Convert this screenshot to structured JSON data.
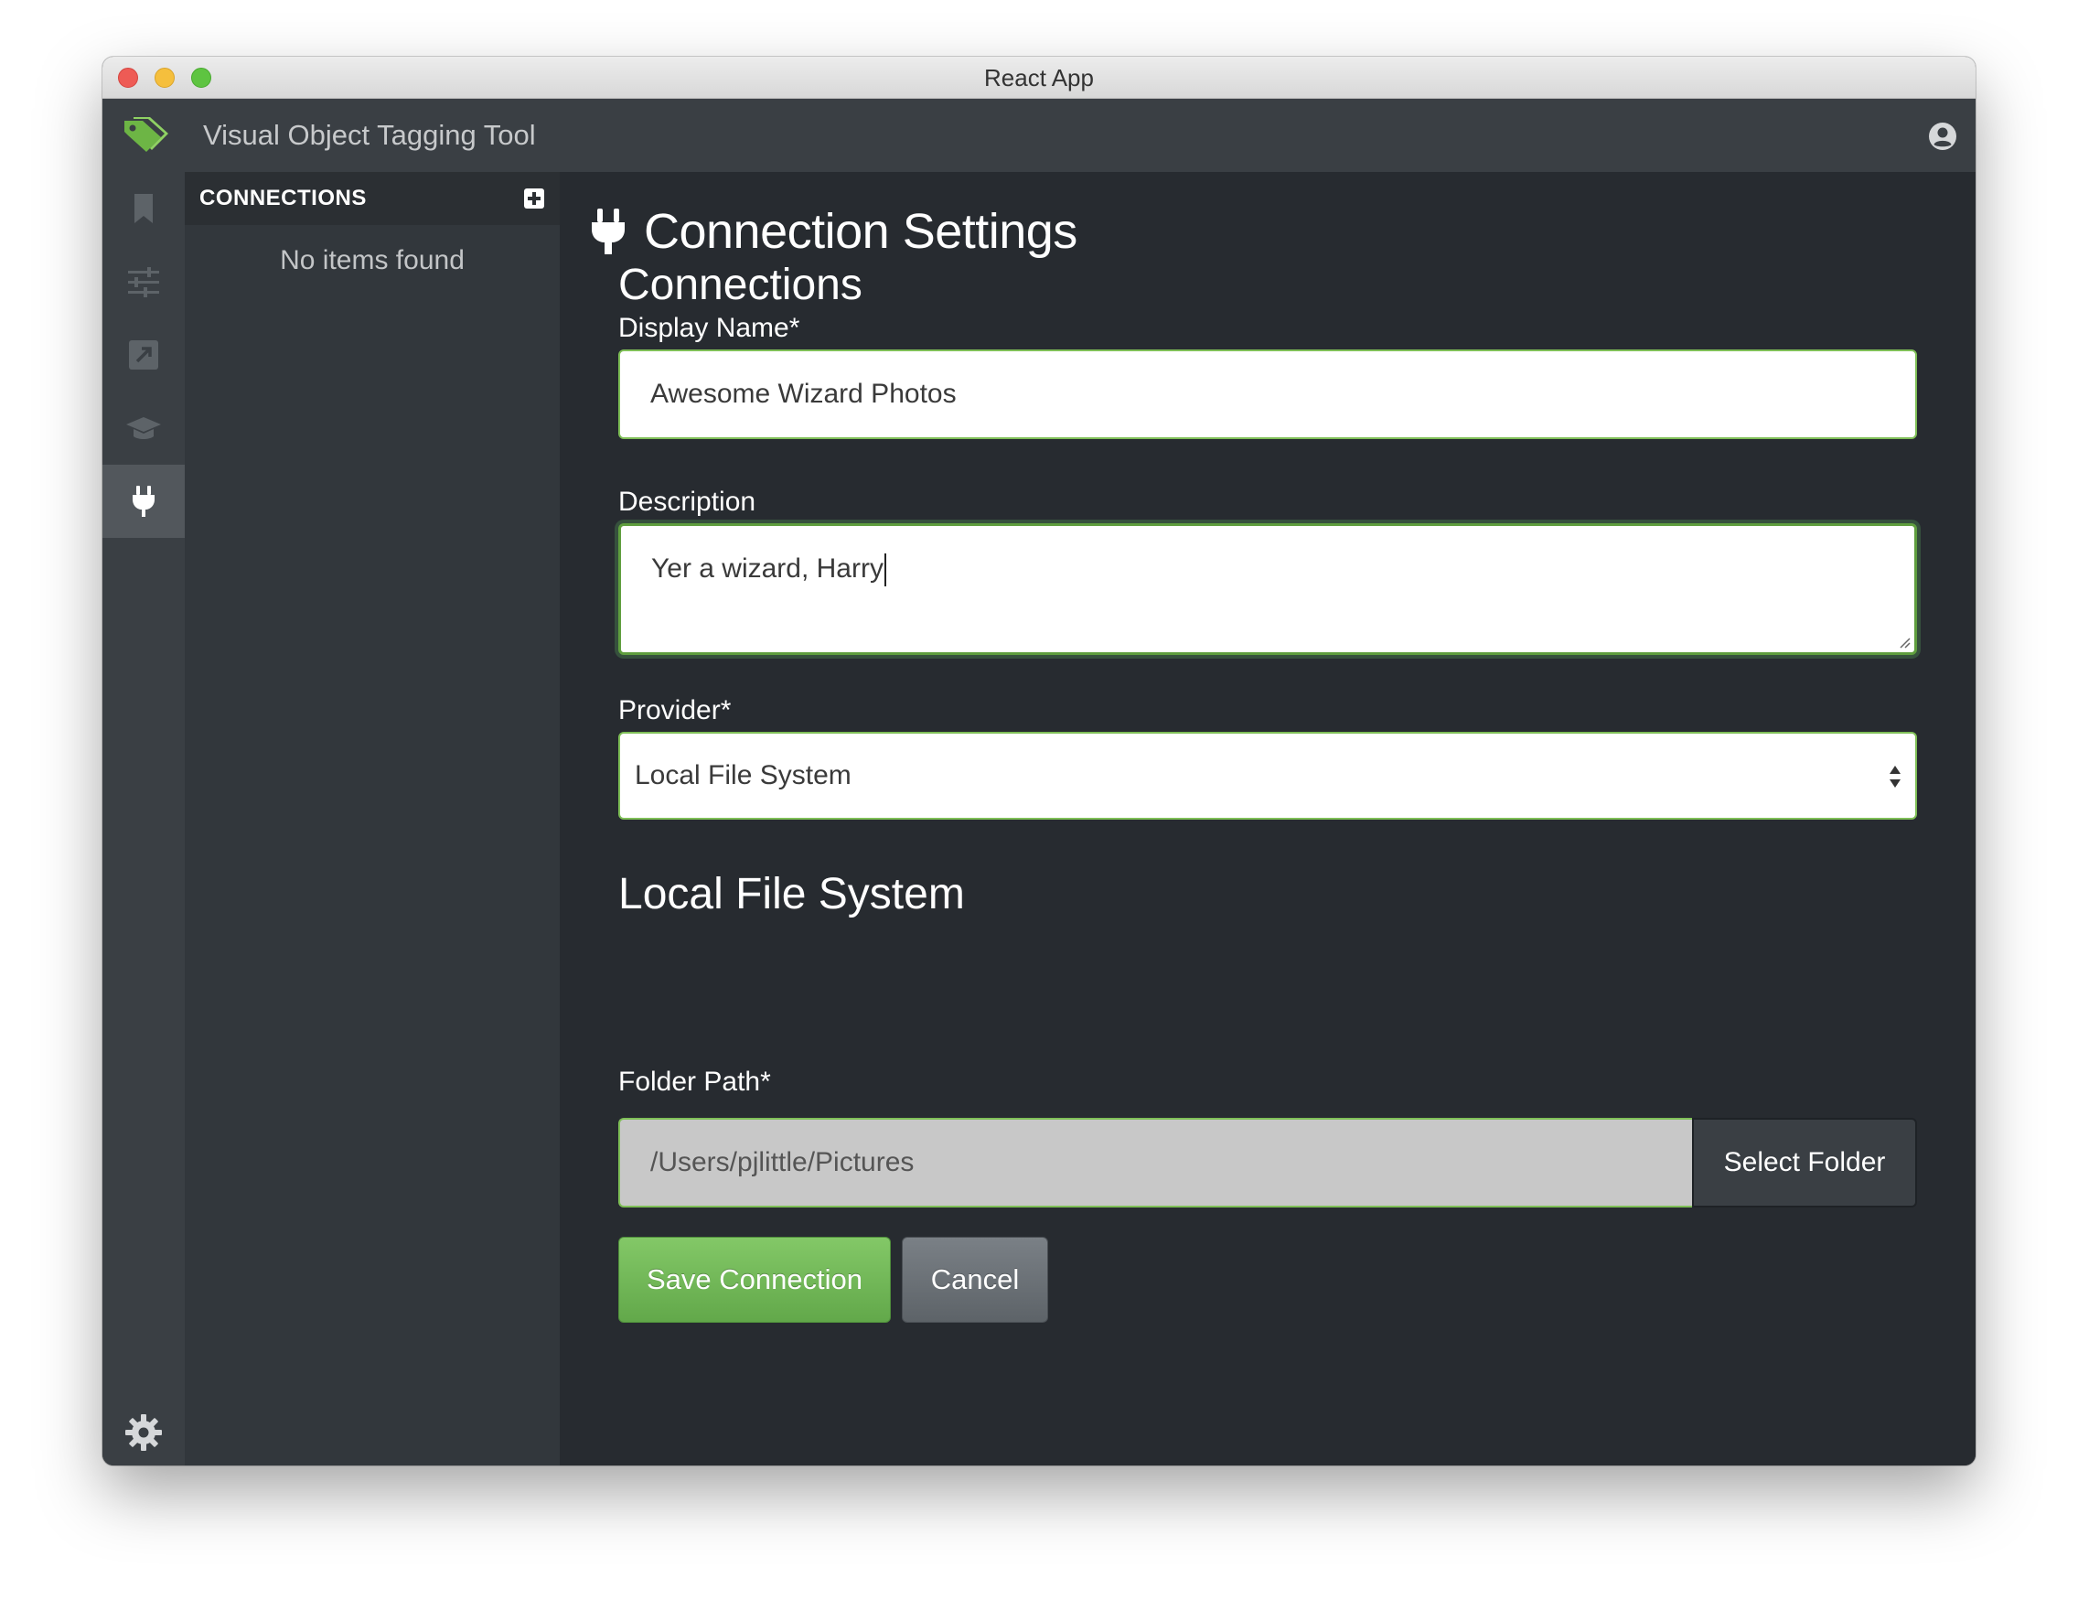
{
  "window": {
    "title": "React App"
  },
  "header": {
    "app_title": "Visual Object Tagging Tool"
  },
  "rail": {
    "items": [
      {
        "icon": "bookmark-icon",
        "active": false
      },
      {
        "icon": "sliders-icon",
        "active": false
      },
      {
        "icon": "export-icon",
        "active": false
      },
      {
        "icon": "graduation-cap-icon",
        "active": false
      },
      {
        "icon": "plug-icon",
        "active": true
      }
    ],
    "bottom_icon": "gear-icon"
  },
  "side_panel": {
    "title": "CONNECTIONS",
    "empty_text": "No items found"
  },
  "main": {
    "page_title": "Connection Settings",
    "section_title": "Connections",
    "display_name": {
      "label": "Display Name*",
      "value": "Awesome Wizard Photos"
    },
    "description": {
      "label": "Description",
      "value": "Yer a wizard, Harry"
    },
    "provider": {
      "label": "Provider*",
      "selected": "Local File System"
    },
    "provider_section_title": "Local File System",
    "folder_path": {
      "label": "Folder Path*",
      "value": "/Users/pjlittle/Pictures",
      "button_label": "Select Folder"
    },
    "actions": {
      "save_label": "Save Connection",
      "cancel_label": "Cancel"
    }
  },
  "colors": {
    "accent_green": "#7fbf57",
    "background_dark": "#272b30",
    "panel": "#32373c",
    "header": "#3a3f44"
  }
}
